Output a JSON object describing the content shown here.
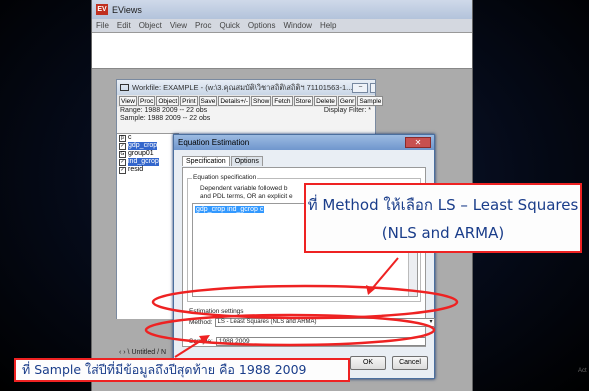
{
  "app": {
    "title": "EViews",
    "logo_glyph": "EV",
    "menu": [
      "File",
      "Edit",
      "Object",
      "View",
      "Proc",
      "Quick",
      "Options",
      "Window",
      "Help"
    ]
  },
  "workfile": {
    "title": "Workfile: EXAMPLE - (w:\\3.คุณสมบัติ\\วิชาสถิติ\\สถิติฯ 71101563-1...",
    "window_controls": [
      "−",
      "□",
      "✕"
    ],
    "toolbar": [
      "View",
      "Proc",
      "Object",
      "Print",
      "Save",
      "Details+/-",
      "Show",
      "Fetch",
      "Store",
      "Delete",
      "Genr",
      "Sample"
    ],
    "range": "Range:  1988 2009  --  22 obs",
    "sample": "Sample: 1988 2009  --  22 obs",
    "display_filter": "Display Filter: *",
    "items": [
      {
        "icon": "β",
        "name": "c",
        "selected": false
      },
      {
        "icon": "✓",
        "name": "gdp_crop",
        "selected": true
      },
      {
        "icon": "G",
        "name": "group01",
        "selected": false
      },
      {
        "icon": "✓",
        "name": "ind_gcrop",
        "selected": true
      },
      {
        "icon": "✓",
        "name": "resid",
        "selected": false
      }
    ],
    "sheet_tabs": "‹ › \\ Untitled / N"
  },
  "dialog": {
    "title": "Equation Estimation",
    "close_label": "✕",
    "tabs": [
      "Specification",
      "Options"
    ],
    "eq_spec_label": "Equation specification",
    "eq_help_line1": "Dependent variable followed b",
    "eq_help_line2": "and PDL terms, OR an explicit e",
    "eq_text": "gdp_crop ind_gcrop c",
    "est_settings_label": "Estimation settings",
    "method_label": "Method:",
    "method_value": "LS - Least Squares (NLS and ARMA)",
    "sample_label": "Sample:",
    "sample_value": "1988 2009",
    "ok_label": "OK",
    "cancel_label": "Cancel"
  },
  "annotations": {
    "callout_line1": "ที่ Method ให้เลือก LS – Least Squares",
    "callout_line2": "(NLS and ARMA)",
    "bottom_note": "ที่ Sample ใส่ปีที่มีข้อมูลถึงปีสุดท้าย คือ 1988 2009",
    "watermark": "Act",
    "highlight_color": "#ee2222",
    "text_color": "#1a3d8a"
  }
}
